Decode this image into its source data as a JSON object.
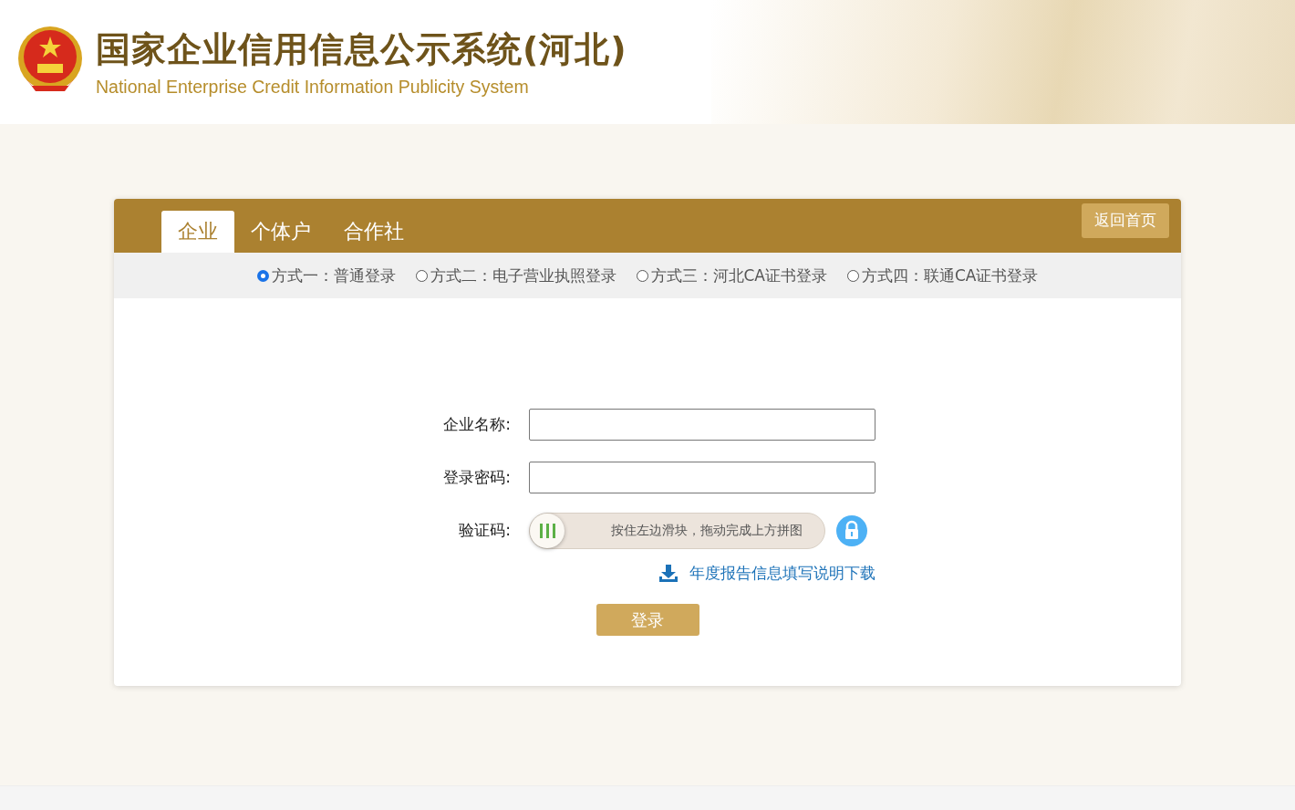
{
  "header": {
    "title": "国家企业信用信息公示系统(河北)",
    "subtitle": "National Enterprise Credit Information Publicity System"
  },
  "tabs": [
    {
      "label": "企业",
      "selected": true
    },
    {
      "label": "个体户",
      "selected": false
    },
    {
      "label": "合作社",
      "selected": false
    }
  ],
  "home_button": "返回首页",
  "login_methods": [
    {
      "label": "方式一：普通登录",
      "selected": true
    },
    {
      "label": "方式二：电子营业执照登录",
      "selected": false
    },
    {
      "label": "方式三：河北CA证书登录",
      "selected": false
    },
    {
      "label": "方式四：联通CA证书登录",
      "selected": false
    }
  ],
  "fields": [
    {
      "label": "企业名称:"
    },
    {
      "label": "登录密码:"
    }
  ],
  "captcha": {
    "label": "验证码:",
    "hint": "按住左边滑块，拖动完成上方拼图",
    "level": 0
  },
  "download_link": "年度报告信息填写说明下载",
  "login_button": "登录"
}
